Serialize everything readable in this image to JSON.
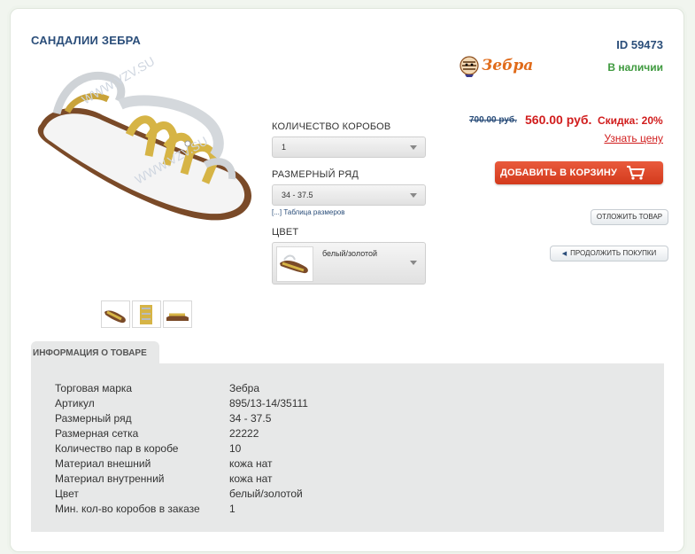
{
  "product": {
    "title": "САНДАЛИИ ЗЕБРА",
    "id_label": "ID 59473",
    "brand_logo_text": "Зебра",
    "stock_status": "В наличии",
    "old_price": "700.00 руб.",
    "new_price": "560.00 руб.",
    "discount": "Скидка: 20%",
    "know_price_link": "Узнать цену",
    "watermark": "WWW.VZV.SU",
    "colors": {
      "accent": "#d33a1c",
      "title": "#2b4e7a",
      "stock": "#3f9a3f",
      "price": "#d11d1d"
    }
  },
  "actions": {
    "add_to_cart": "ДОБАВИТЬ В КОРЗИНУ",
    "defer": "ОТЛОЖИТЬ ТОВАР",
    "continue": "ПРОДОЛЖИТЬ ПОКУПКИ"
  },
  "options": {
    "boxes_label": "КОЛИЧЕСТВО КОРОБОВ",
    "boxes_value": "1",
    "size_label": "РАЗМЕРНЫЙ РЯД",
    "size_value": "34 - 37.5",
    "size_table_link": "[...] Таблица размеров",
    "color_label": "ЦВЕТ",
    "color_value": "белый/золотой"
  },
  "info": {
    "tab_label": "ИНФОРМАЦИЯ О ТОВАРЕ",
    "rows": [
      {
        "key": "Торговая марка",
        "value": "Зебра"
      },
      {
        "key": "Артикул",
        "value": "895/13-14/35111"
      },
      {
        "key": "Размерный ряд",
        "value": "34 - 37.5"
      },
      {
        "key": "Размерная сетка",
        "value": "22222"
      },
      {
        "key": "Количество пар в коробе",
        "value": "10"
      },
      {
        "key": "Материал внешний",
        "value": "кожа нат"
      },
      {
        "key": "Материал внутренний",
        "value": "кожа нат"
      },
      {
        "key": "Цвет",
        "value": "белый/золотой"
      },
      {
        "key": "Мин. кол-во коробов в заказе",
        "value": "1"
      }
    ]
  }
}
